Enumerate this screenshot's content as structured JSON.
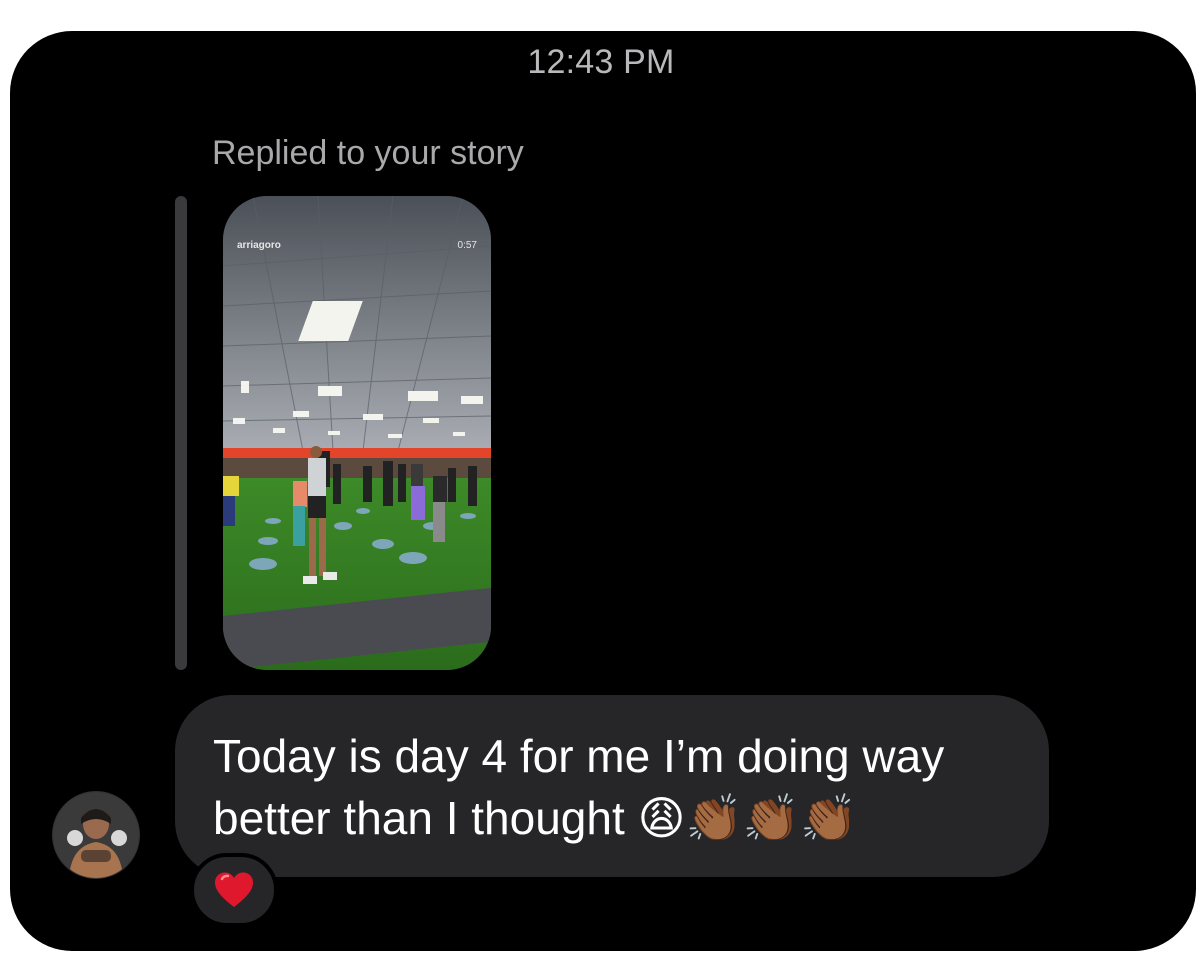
{
  "conversation": {
    "timestamp": "12:43 PM",
    "reply_context": "Replied to your story",
    "story": {
      "username": "arriagoro",
      "duration": "0:57"
    },
    "message": {
      "text": "Today is day 4 for me I’m doing way better than I thought 😩👏🏾👏🏾👏🏾"
    },
    "reaction": "heart-icon"
  },
  "colors": {
    "background": "#000000",
    "bubble": "#262628",
    "reply_bar": "#3a3a3c",
    "secondary_text": "#a9a9ac",
    "heart": "#e0182d"
  }
}
